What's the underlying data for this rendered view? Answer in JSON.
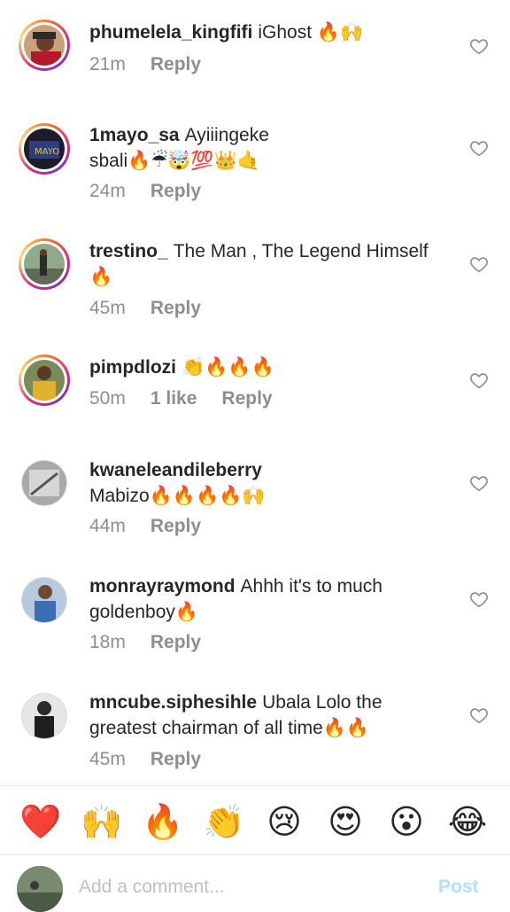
{
  "comments": [
    {
      "username": "phumelela_kingfifi",
      "text": "iGhost 🔥🙌",
      "time": "21m",
      "likes": "",
      "reply": "Reply"
    },
    {
      "username": "1mayo_sa",
      "text": "Ayiiingeke sbali🔥☔🤯💯👑🤙",
      "time": "24m",
      "likes": "",
      "reply": "Reply"
    },
    {
      "username": "trestino_",
      "text": "The Man , The Legend Himself 🔥",
      "time": "45m",
      "likes": "",
      "reply": "Reply"
    },
    {
      "username": "pimpdlozi",
      "text": "👏🔥🔥🔥",
      "time": "50m",
      "likes": "1 like",
      "reply": "Reply"
    },
    {
      "username": "kwaneleandileberry",
      "text": "Mabizo🔥🔥🔥🔥🙌",
      "time": "44m",
      "likes": "",
      "reply": "Reply"
    },
    {
      "username": "monrayraymond",
      "text": "Ahhh it's to much goldenboy🔥",
      "time": "18m",
      "likes": "",
      "reply": "Reply"
    },
    {
      "username": "mncube.siphesihle",
      "text": "Ubala Lolo the greatest chairman of all time🔥🔥",
      "time": "45m",
      "likes": "",
      "reply": "Reply"
    }
  ],
  "reactions": [
    "❤️",
    "🙌",
    "🔥",
    "👏",
    "😢",
    "😍",
    "😮",
    "😂"
  ],
  "composer": {
    "placeholder": "Add a comment...",
    "post_label": "Post"
  },
  "colors": {
    "post_disabled": "#b2dffc",
    "meta_gray": "#8e8e8e",
    "text": "#262626"
  }
}
